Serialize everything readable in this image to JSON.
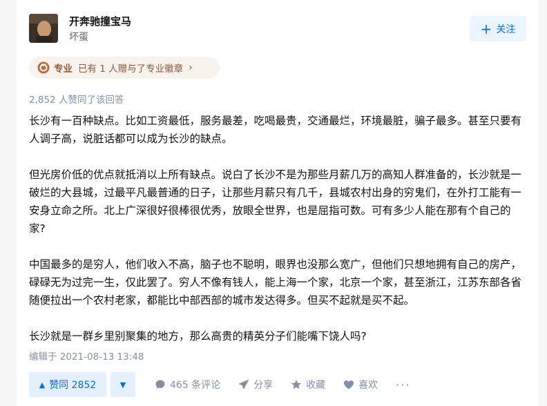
{
  "author": {
    "name": "开奔驰撞宝马",
    "bio": "坏蛋",
    "follow_label": "关注"
  },
  "badge": {
    "keyword": "专业",
    "text": "已有 1 人赠与了专业徽章",
    "chevron": "›"
  },
  "answer": {
    "vote_summary": "2,852 人赞同了该回答",
    "paragraphs": [
      "长沙有一百种缺点。比如工资最低，服务最差，吃喝最贵，交通最烂，环境最脏，骗子最多。甚至只要有人调子高，说脏话都可以成为长沙的缺点。",
      "但光房价低的优点就抵消以上所有缺点。说白了长沙不是为那些月薪几万的高知人群准备的，长沙就是一破烂的大县城，过最平凡最普通的日子，让那些月薪只有几千，县城农村出身的穷鬼们，在外打工能有一安身立命之所。北上广深很好很棒很优秀，放眼全世界，也是屈指可数。可有多少人能在那有个自己的家?",
      "中国最多的是穷人，他们收入不高，脑子也不聪明，眼界也没那么宽广，但他们只想地拥有自己的房产，碌碌无为过完一生，仅此罢了。穷人不像有钱人，能上海一个家，北京一个家，甚至浙江，江苏东部各省随便拉出一个农村老家，都能比中部西部的城市发达得多。但买不起就是买不起。",
      "长沙就是一群乡里别聚集的地方，那么高贵的精英分子们能嘴下饶人吗?"
    ],
    "edit_time": "编辑于 2021-08-13 13:48"
  },
  "actions": {
    "vote_up_label": "赞同 2852",
    "comments_label": "465 条评论",
    "share_label": "分享",
    "favorite_label": "收藏",
    "like_label": "喜欢",
    "more_label": "···"
  },
  "colors": {
    "accent": "#056de8",
    "muted": "#8590a6",
    "badge_text": "#8c5a3c",
    "badge_bg": "#f9f3ee"
  },
  "icons": [
    "plus-icon",
    "medal-icon",
    "chevron-right-icon",
    "upvote-triangle-icon",
    "downvote-triangle-icon",
    "comment-icon",
    "share-icon",
    "favorite-star-icon",
    "heart-icon",
    "more-icon"
  ]
}
